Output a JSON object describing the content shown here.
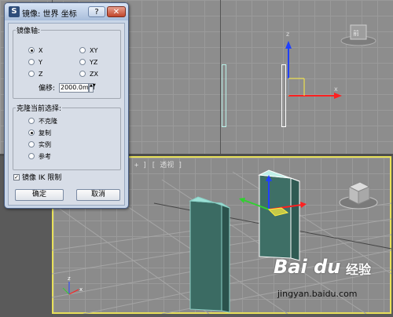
{
  "viewports": {
    "persp_label": "[ + ] [ 透视 ]"
  },
  "dialog": {
    "title": "镜像: 世界 坐标",
    "help_label": "?",
    "close_label": "✕",
    "mirror_axis_group": "镜像轴:",
    "axes": [
      {
        "label": "X",
        "selected": true
      },
      {
        "label": "XY",
        "selected": false
      },
      {
        "label": "Y",
        "selected": false
      },
      {
        "label": "YZ",
        "selected": false
      },
      {
        "label": "Z",
        "selected": false
      },
      {
        "label": "ZX",
        "selected": false
      }
    ],
    "offset_label": "偏移:",
    "offset_value": "2000.0mm",
    "clone_group": "克隆当前选择:",
    "clone_options": [
      {
        "label": "不克隆",
        "selected": false
      },
      {
        "label": "复制",
        "selected": true
      },
      {
        "label": "实例",
        "selected": false
      },
      {
        "label": "参考",
        "selected": false
      }
    ],
    "mirror_ik_label": "镜像 IK 限制",
    "mirror_ik_checked": true,
    "ok_label": "确定",
    "cancel_label": "取消"
  },
  "watermark": {
    "logo": "Bai du",
    "brand": "经验",
    "url": "jingyan.baidu.com"
  },
  "colors": {
    "active_viewport_border": "#e8e05a",
    "axis_x": "#ff2020",
    "axis_y": "#30d030",
    "axis_z": "#2040ff",
    "panel_fill": "#3b6b63",
    "panel_edge": "#88cfc4"
  }
}
